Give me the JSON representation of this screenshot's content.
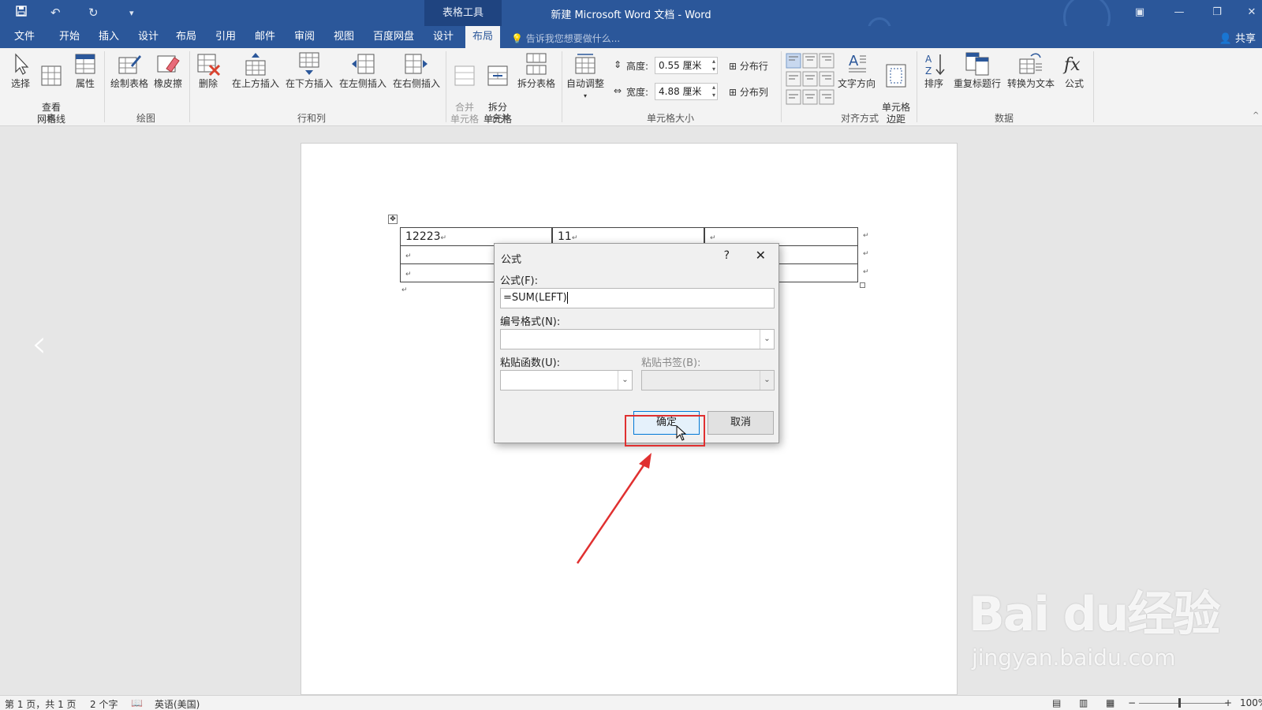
{
  "title_bar": {
    "contextual_group": "表格工具",
    "document_title": "新建 Microsoft Word 文档 - Word"
  },
  "tabs": [
    {
      "label": "文件"
    },
    {
      "label": "开始"
    },
    {
      "label": "插入"
    },
    {
      "label": "设计"
    },
    {
      "label": "布局"
    },
    {
      "label": "引用"
    },
    {
      "label": "邮件"
    },
    {
      "label": "审阅"
    },
    {
      "label": "视图"
    },
    {
      "label": "百度网盘"
    },
    {
      "label": "设计"
    },
    {
      "label": "布局"
    }
  ],
  "active_tab_index": 11,
  "tell_me": "告诉我您想要做什么...",
  "share": "共享",
  "ribbon": {
    "table": {
      "label": "表",
      "select": "选择",
      "gridlines": "查看\n网格线",
      "properties": "属性"
    },
    "draw": {
      "label": "绘图",
      "draw_table": "绘制表格",
      "eraser": "橡皮擦"
    },
    "rows_cols": {
      "label": "行和列",
      "delete": "删除",
      "insert_above": "在上方插入",
      "insert_below": "在下方插入",
      "insert_left": "在左侧插入",
      "insert_right": "在右侧插入"
    },
    "merge": {
      "label": "合并",
      "merge_cells": "合并\n单元格",
      "split_cells": "拆分\n单元格",
      "split_table": "拆分表格"
    },
    "cell_size": {
      "label": "单元格大小",
      "autofit": "自动调整",
      "height_label": "高度:",
      "height_value": "0.55 厘米",
      "width_label": "宽度:",
      "width_value": "4.88 厘米",
      "distribute_rows": "分布行",
      "distribute_cols": "分布列"
    },
    "alignment": {
      "label": "对齐方式",
      "text_direction": "文字方向",
      "cell_margins": "单元格\n边距"
    },
    "data": {
      "label": "数据",
      "sort": "排序",
      "repeat_header": "重复标题行",
      "convert_text": "转换为文本",
      "formula": "公式"
    }
  },
  "document": {
    "table": [
      [
        "12223",
        "11",
        ""
      ],
      [
        "",
        "",
        ""
      ],
      [
        "",
        "",
        ""
      ]
    ]
  },
  "dialog": {
    "title": "公式",
    "help": "?",
    "formula_label": "公式(F):",
    "formula_value": "=SUM(LEFT)",
    "number_format_label": "编号格式(N):",
    "number_format_value": "",
    "paste_function_label": "粘贴函数(U):",
    "paste_bookmark_label": "粘贴书签(B):",
    "ok": "确定",
    "cancel": "取消"
  },
  "watermark": {
    "brand": "Bai du经验",
    "url": "jingyan.baidu.com"
  },
  "status_bar": {
    "page": "第 1 页，共 1 页",
    "words": "2 个字",
    "language": "英语(美国)",
    "zoom": "100%"
  },
  "colors": {
    "accent": "#2b579a",
    "highlight": "#e03030",
    "arrow": "#e03030"
  }
}
